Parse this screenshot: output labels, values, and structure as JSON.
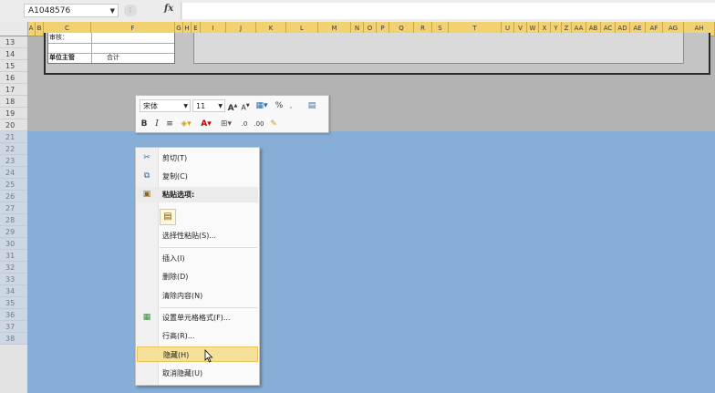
{
  "formula_bar": {
    "name_box": "A1048576",
    "fx_label": "fx"
  },
  "columns": [
    "A",
    "B",
    "C",
    "F",
    "G",
    "H",
    "E",
    "I",
    "J",
    "K",
    "L",
    "M",
    "N",
    "O",
    "P",
    "Q",
    "R",
    "S",
    "T",
    "U",
    "V",
    "W",
    "X",
    "Y",
    "Z",
    "AA",
    "AB",
    "AC",
    "AD",
    "AE",
    "AF",
    "AG",
    "AH"
  ],
  "rows": [
    "13",
    "14",
    "15",
    "16",
    "17",
    "18",
    "19",
    "20",
    "21",
    "22",
    "23",
    "24",
    "25",
    "26",
    "27",
    "28",
    "29",
    "30",
    "31",
    "32",
    "33",
    "34",
    "35",
    "36",
    "37",
    "38"
  ],
  "sheet": {
    "cell_13_c": "审核：",
    "cell_14_c": "单位主管",
    "cell_14_f": "合计"
  },
  "mini_toolbar": {
    "font": "宋体",
    "size": "11"
  },
  "context_menu": {
    "items": [
      {
        "label": "剪切(T)",
        "icon": "scissors-icon",
        "glyph": "✂"
      },
      {
        "label": "复制(C)",
        "icon": "copy-icon",
        "glyph": "⧉"
      },
      {
        "label": "粘贴选项:",
        "icon": "paste-icon",
        "glyph": "📋"
      },
      {
        "label": "选择性粘贴(S)...",
        "icon": "",
        "glyph": ""
      },
      {
        "label": "插入(I)",
        "icon": "",
        "glyph": ""
      },
      {
        "label": "删除(D)",
        "icon": "",
        "glyph": ""
      },
      {
        "label": "清除内容(N)",
        "icon": "",
        "glyph": ""
      },
      {
        "label": "设置单元格格式(F)...",
        "icon": "format-cells-icon",
        "glyph": "▦"
      },
      {
        "label": "行高(R)...",
        "icon": "",
        "glyph": ""
      },
      {
        "label": "隐藏(H)",
        "icon": "",
        "glyph": ""
      },
      {
        "label": "取消隐藏(U)",
        "icon": "",
        "glyph": ""
      }
    ]
  }
}
